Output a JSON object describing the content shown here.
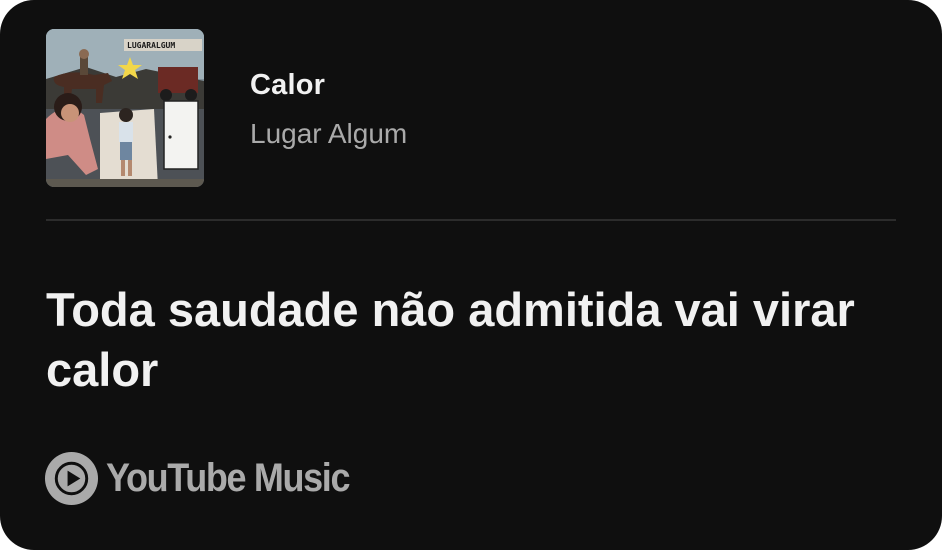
{
  "song": {
    "title": "Calor",
    "artist": "Lugar Algum",
    "album_art_text": "LUGARALGUM"
  },
  "lyric": {
    "text": "Toda saudade não admitida vai virar calor"
  },
  "brand": {
    "name": "YouTube Music",
    "icon": "youtube-music-play-icon"
  },
  "colors": {
    "card_background": "#0f0f0f",
    "title_text": "#f1f1f1",
    "secondary_text": "#aaaaaa",
    "divider": "#2c2c2c"
  }
}
